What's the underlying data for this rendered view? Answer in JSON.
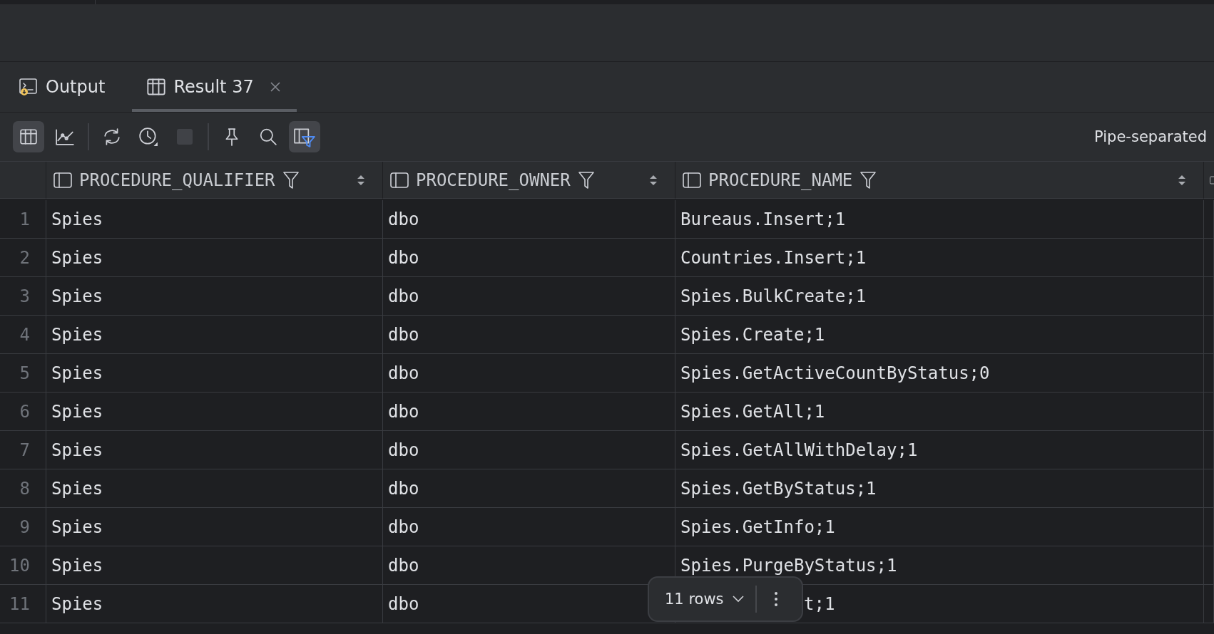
{
  "tabs": [
    {
      "kind": "output",
      "label": "Output",
      "selected": false,
      "closable": false
    },
    {
      "kind": "result",
      "label": "Result 37",
      "selected": true,
      "closable": true
    }
  ],
  "toolbar": [
    {
      "buttons": [
        {
          "kind": "table",
          "selected": true,
          "disabled": false
        },
        {
          "kind": "chart",
          "selected": false,
          "disabled": false
        }
      ]
    },
    {
      "buttons": [
        {
          "kind": "refresh",
          "selected": false,
          "disabled": false
        },
        {
          "kind": "history",
          "selected": false,
          "disabled": false
        },
        {
          "kind": "stop",
          "selected": false,
          "disabled": true
        }
      ]
    },
    {
      "buttons": [
        {
          "kind": "pin",
          "selected": false,
          "disabled": false
        },
        {
          "kind": "search",
          "selected": false,
          "disabled": false
        },
        {
          "kind": "filter-columns",
          "selected": true,
          "disabled": false
        }
      ]
    }
  ],
  "export_format": "Pipe-separated",
  "table": {
    "columns": [
      {
        "name": "PROCEDURE_QUALIFIER"
      },
      {
        "name": "PROCEDURE_OWNER"
      },
      {
        "name": "PROCEDURE_NAME"
      }
    ],
    "rows": [
      {
        "number": "1",
        "cells": [
          "Spies",
          "dbo",
          "Bureaus.Insert;1"
        ],
        "name_covered": false
      },
      {
        "number": "2",
        "cells": [
          "Spies",
          "dbo",
          "Countries.Insert;1"
        ],
        "name_covered": false
      },
      {
        "number": "3",
        "cells": [
          "Spies",
          "dbo",
          "Spies.BulkCreate;1"
        ],
        "name_covered": false
      },
      {
        "number": "4",
        "cells": [
          "Spies",
          "dbo",
          "Spies.Create;1"
        ],
        "name_covered": false
      },
      {
        "number": "5",
        "cells": [
          "Spies",
          "dbo",
          "Spies.GetActiveCountByStatus;0"
        ],
        "name_covered": false
      },
      {
        "number": "6",
        "cells": [
          "Spies",
          "dbo",
          "Spies.GetAll;1"
        ],
        "name_covered": false
      },
      {
        "number": "7",
        "cells": [
          "Spies",
          "dbo",
          "Spies.GetAllWithDelay;1"
        ],
        "name_covered": false
      },
      {
        "number": "8",
        "cells": [
          "Spies",
          "dbo",
          "Spies.GetByStatus;1"
        ],
        "name_covered": false
      },
      {
        "number": "9",
        "cells": [
          "Spies",
          "dbo",
          "Spies.GetInfo;1"
        ],
        "name_covered": false
      },
      {
        "number": "10",
        "cells": [
          "Spies",
          "dbo",
          "Spies.PurgeByStatus;1"
        ],
        "name_covered": false
      },
      {
        "number": "11",
        "cells": [
          "Spies",
          "dbo",
          "t;1"
        ],
        "name_covered": true
      }
    ]
  },
  "row_count": "11 rows"
}
